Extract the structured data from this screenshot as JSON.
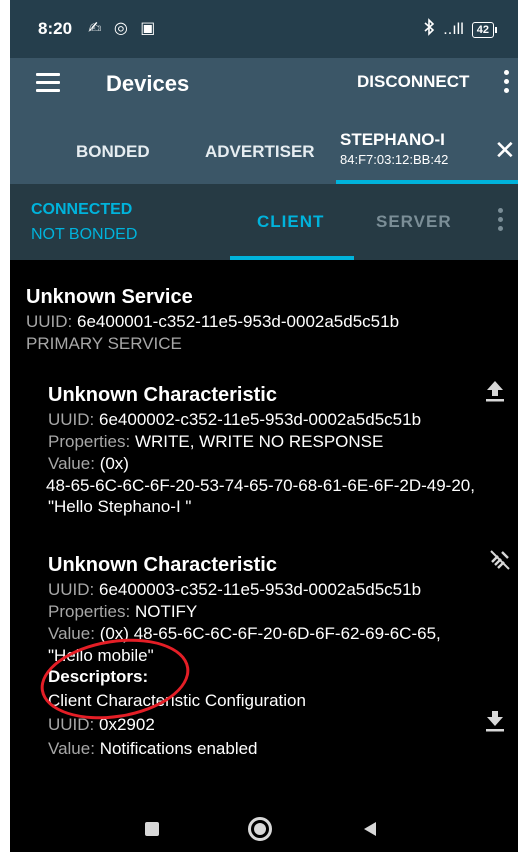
{
  "status_bar": {
    "time": "8:20",
    "left_icons": "✍ ◎ ▣",
    "bluetooth_icon": "bluetooth-icon",
    "signal": "..ıll",
    "battery": "42"
  },
  "app_bar": {
    "title": "Devices",
    "disconnect_label": "DISCONNECT"
  },
  "device_tabs": {
    "items": [
      {
        "label": "BONDED"
      },
      {
        "label": "ADVERTISER"
      }
    ],
    "active": {
      "name": "STEPHANO-I",
      "mac": "84:F7:03:12:BB:42",
      "close_icon": "close-icon"
    }
  },
  "connection": {
    "state": "CONNECTED",
    "bond": "NOT BONDED",
    "tabs": [
      "CLIENT",
      "SERVER"
    ],
    "selected_tab": "CLIENT"
  },
  "service": {
    "name": "Unknown Service",
    "uuid_label": "UUID:",
    "uuid": "6e400001-c352-11e5-953d-0002a5d5c51b",
    "type": "PRIMARY SERVICE"
  },
  "characteristics": [
    {
      "name": "Unknown Characteristic",
      "uuid_label": "UUID:",
      "uuid": "6e400002-c352-11e5-953d-0002a5d5c51b",
      "properties_label": "Properties:",
      "properties": "WRITE, WRITE NO RESPONSE",
      "value_label": "Value:",
      "value_prefix": "(0x)",
      "value_hex": "48-65-6C-6C-6F-20-53-74-65-70-68-61-6E-6F-2D-49-20,",
      "value_text": "\"Hello Stephano-I \"",
      "action_icon": "upload-icon"
    },
    {
      "name": "Unknown Characteristic",
      "uuid_label": "UUID:",
      "uuid": "6e400003-c352-11e5-953d-0002a5d5c51b",
      "properties_label": "Properties:",
      "properties": "NOTIFY",
      "value_label": "Value:",
      "value_prefix": "(0x)",
      "value_hex": "48-65-6C-6C-6F-20-6D-6F-62-69-6C-65,",
      "value_text": "\"Hello mobile\"",
      "action_icon": "notifications-disabled-icon",
      "descriptors_label": "Descriptors:",
      "descriptor": {
        "name": "Client Characteristic Configuration",
        "uuid_label": "UUID:",
        "uuid": "0x2902",
        "value_label": "Value:",
        "value": "Notifications enabled",
        "action_icon": "download-icon"
      }
    }
  ],
  "colors": {
    "accent": "#00b3dc",
    "app_bar": "#3b5667",
    "status_bar": "#253e4c",
    "connection_bar": "#263a44",
    "annotation": "#e41e26"
  }
}
